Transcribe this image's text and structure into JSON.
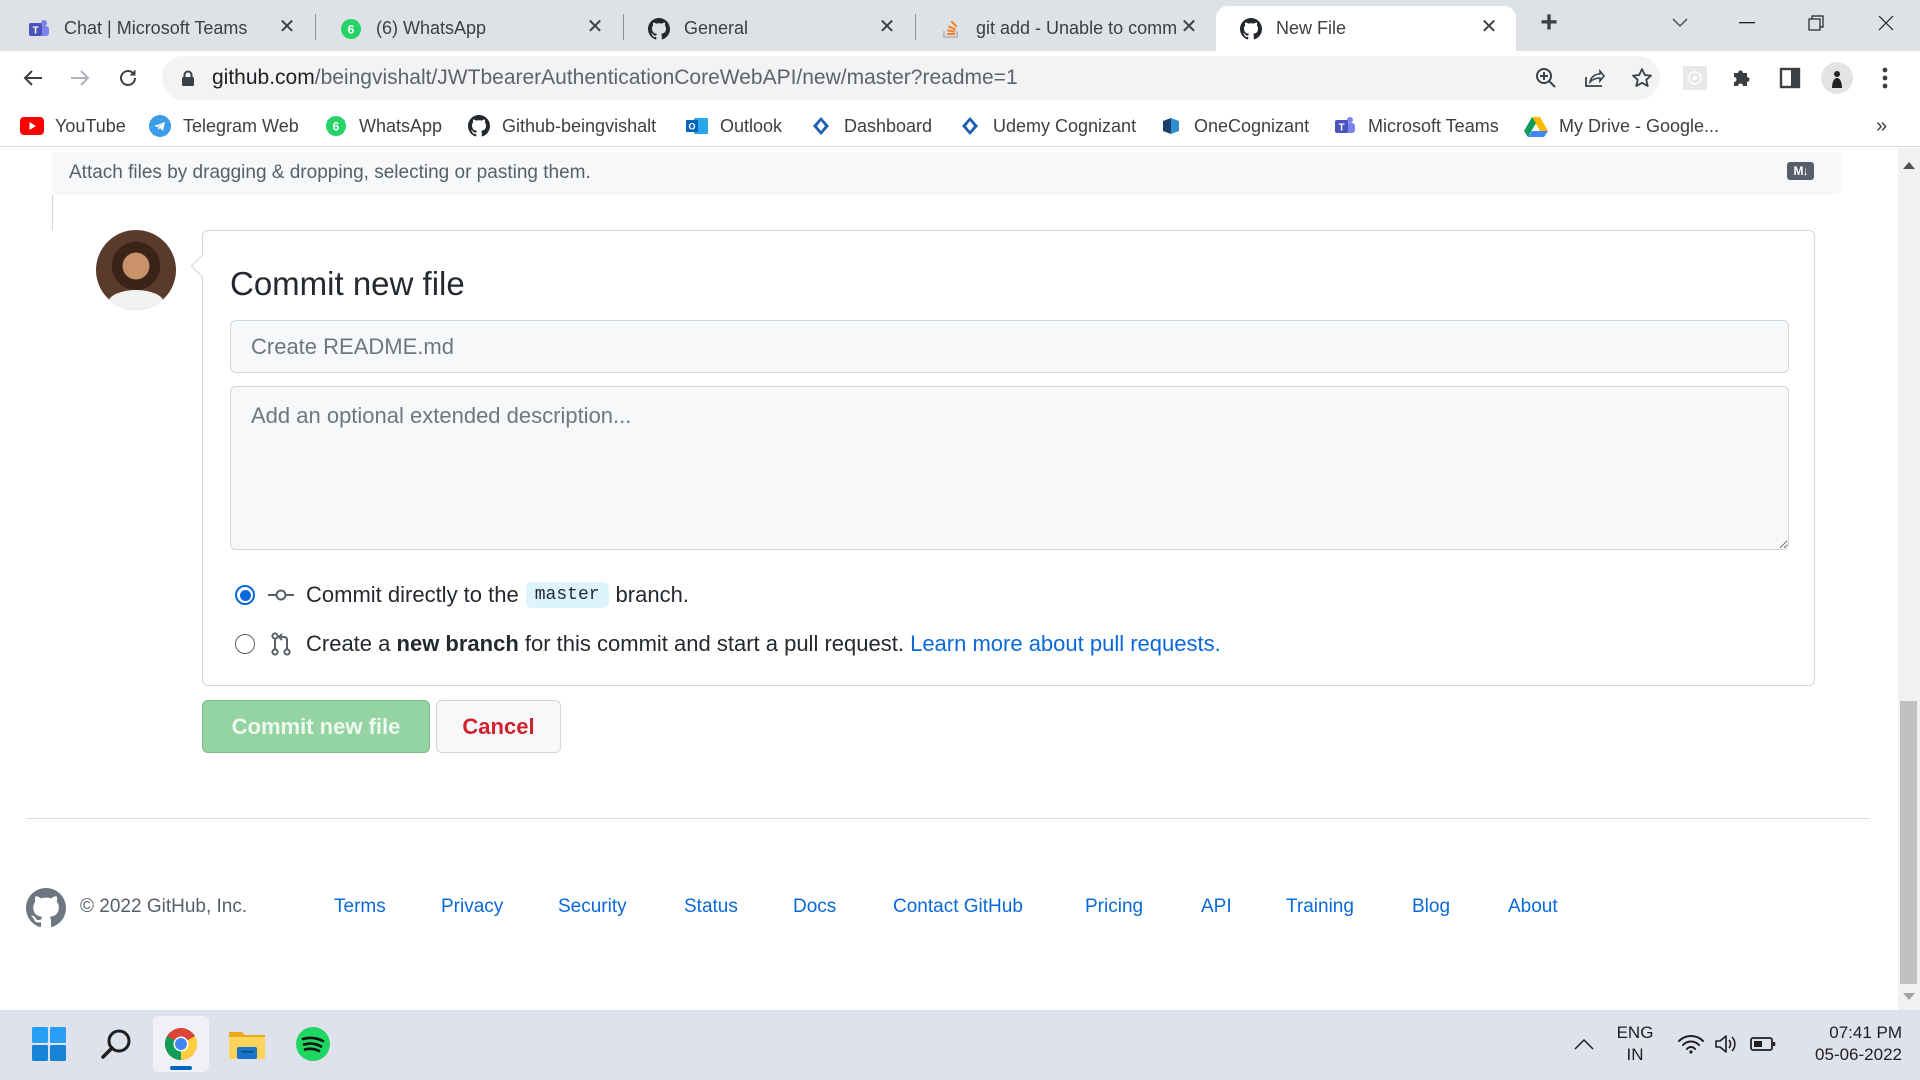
{
  "browser": {
    "tabs": [
      {
        "title": "Chat | Microsoft Teams",
        "icon": "teams-icon",
        "active": false
      },
      {
        "title": "(6) WhatsApp",
        "icon": "whatsapp-icon",
        "active": false
      },
      {
        "title": "General",
        "icon": "github-icon",
        "active": false
      },
      {
        "title": "git add - Unable to comm",
        "icon": "stackoverflow-icon",
        "active": false
      },
      {
        "title": "New File",
        "icon": "github-icon",
        "active": true
      }
    ],
    "new_tab_label": "+",
    "close_glyph": "✕",
    "url_host": "github.com",
    "url_path": "/beingvishalt/JWTbearerAuthenticationCoreWebAPI/new/master?readme=1",
    "bookmarks": [
      {
        "label": "YouTube",
        "icon": "youtube-icon"
      },
      {
        "label": "Telegram Web",
        "icon": "telegram-icon"
      },
      {
        "label": "WhatsApp",
        "icon": "whatsapp-icon"
      },
      {
        "label": "Github-beingvishalt",
        "icon": "github-icon"
      },
      {
        "label": "Outlook",
        "icon": "outlook-icon"
      },
      {
        "label": "Dashboard",
        "icon": "dashboard-icon"
      },
      {
        "label": "Udemy Cognizant",
        "icon": "udemy-cognizant-icon"
      },
      {
        "label": "OneCognizant",
        "icon": "onecognizant-icon"
      },
      {
        "label": "Microsoft Teams",
        "icon": "teams-icon"
      },
      {
        "label": "My Drive - Google...",
        "icon": "google-drive-icon"
      }
    ],
    "bookmarks_overflow": "»",
    "whatsapp_badge": "6"
  },
  "page": {
    "attach_text": "Attach files by dragging & dropping, selecting or pasting them.",
    "markdown_badge": "M↓",
    "commit": {
      "title": "Commit new file",
      "summary_placeholder": "Create README.md",
      "summary_value": "",
      "description_placeholder": "Add an optional extended description...",
      "description_value": "",
      "option_direct": {
        "prefix": "Commit directly to the",
        "branch": "master",
        "suffix": "branch.",
        "checked": true
      },
      "option_new_branch": {
        "prefix": "Create a",
        "bold": "new branch",
        "suffix": "for this commit and start a pull request.",
        "link": "Learn more about pull requests.",
        "checked": false
      },
      "submit_label": "Commit new file",
      "cancel_label": "Cancel"
    },
    "footer": {
      "copyright": "© 2022 GitHub, Inc.",
      "links": [
        "Terms",
        "Privacy",
        "Security",
        "Status",
        "Docs",
        "Contact GitHub",
        "Pricing",
        "API",
        "Training",
        "Blog",
        "About"
      ]
    }
  },
  "taskbar": {
    "apps": [
      "start-button",
      "search",
      "chrome",
      "file-explorer",
      "spotify"
    ],
    "active_app": "chrome",
    "language_line1": "ENG",
    "language_line2": "IN",
    "time": "07:41 PM",
    "date": "05-06-2022"
  },
  "colors": {
    "link": "#0969da",
    "commit_button": "#94d3a2",
    "cancel_text": "#cf222e",
    "radio_checked": "#0969da",
    "branch_badge_bg": "#ddf4ff"
  }
}
